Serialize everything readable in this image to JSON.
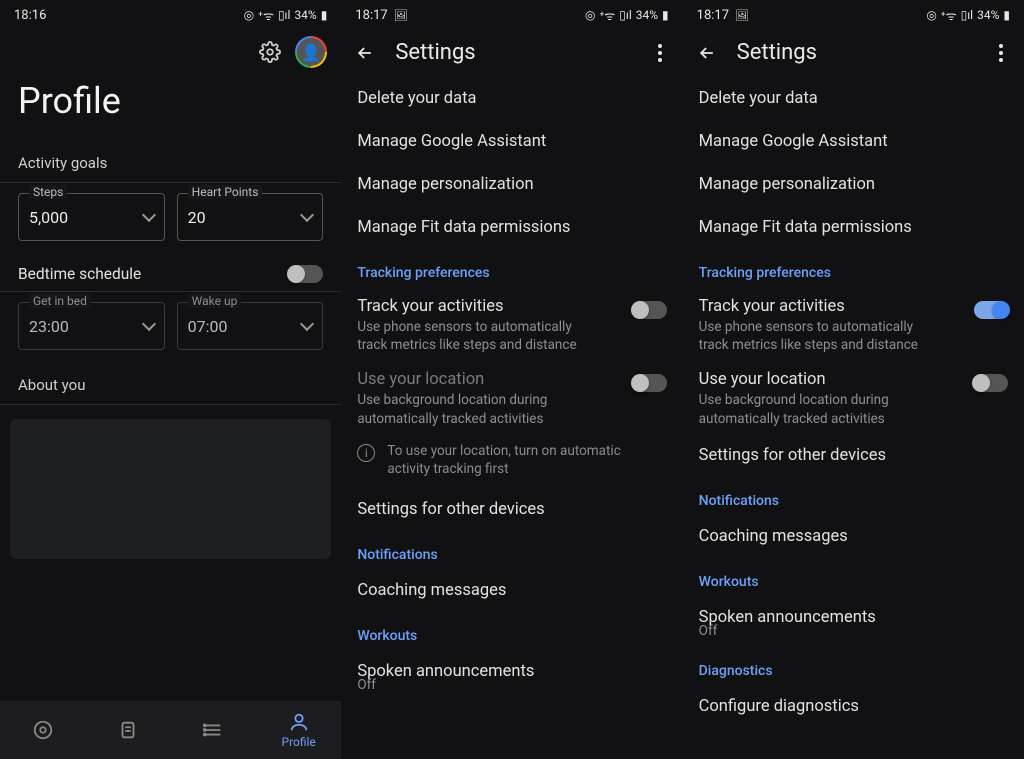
{
  "screen1": {
    "status": {
      "time": "18:16",
      "battery": "34%",
      "has_pic_icon": false
    },
    "title": "Profile",
    "activity_goals_label": "Activity goals",
    "steps": {
      "label": "Steps",
      "value": "5,000"
    },
    "heart": {
      "label": "Heart Points",
      "value": "20"
    },
    "bedtime_label": "Bedtime schedule",
    "bedtime_on": false,
    "get_in_bed": {
      "label": "Get in bed",
      "value": "23:00"
    },
    "wake_up": {
      "label": "Wake up",
      "value": "07:00"
    },
    "about_label": "About you",
    "nav": {
      "profile": "Profile"
    }
  },
  "screen2": {
    "status": {
      "time": "18:17",
      "battery": "34%"
    },
    "title": "Settings",
    "items_top": [
      "Delete your data",
      "Manage Google Assistant",
      "Manage personalization",
      "Manage Fit data permissions"
    ],
    "tracking_header": "Tracking preferences",
    "track": {
      "title": "Track your activities",
      "sub": "Use phone sensors to automatically track metrics like steps and distance",
      "on": false
    },
    "location": {
      "title": "Use your location",
      "sub": "Use background location during automatically tracked activities",
      "on": false,
      "disabled": true
    },
    "info": "To use your location, turn on automatic activity tracking first",
    "other_devices": "Settings for other devices",
    "notif_header": "Notifications",
    "coaching": "Coaching messages",
    "workouts_header": "Workouts",
    "spoken": {
      "title": "Spoken announcements",
      "sub": "Off"
    }
  },
  "screen3": {
    "status": {
      "time": "18:17",
      "battery": "34%"
    },
    "title": "Settings",
    "items_top": [
      "Delete your data",
      "Manage Google Assistant",
      "Manage personalization",
      "Manage Fit data permissions"
    ],
    "tracking_header": "Tracking preferences",
    "track": {
      "title": "Track your activities",
      "sub": "Use phone sensors to automatically track metrics like steps and distance",
      "on": true
    },
    "location": {
      "title": "Use your location",
      "sub": "Use background location during automatically tracked activities",
      "on": false,
      "disabled": false
    },
    "other_devices": "Settings for other devices",
    "notif_header": "Notifications",
    "coaching": "Coaching messages",
    "workouts_header": "Workouts",
    "spoken": {
      "title": "Spoken announcements",
      "sub": "Off"
    },
    "diag_header": "Diagnostics",
    "diag_item": "Configure diagnostics"
  },
  "status_icons": {
    "hotspot": "◎",
    "wifi_plus": "⁺ᯤ",
    "signal": "▯ıl",
    "batt": "▮"
  }
}
